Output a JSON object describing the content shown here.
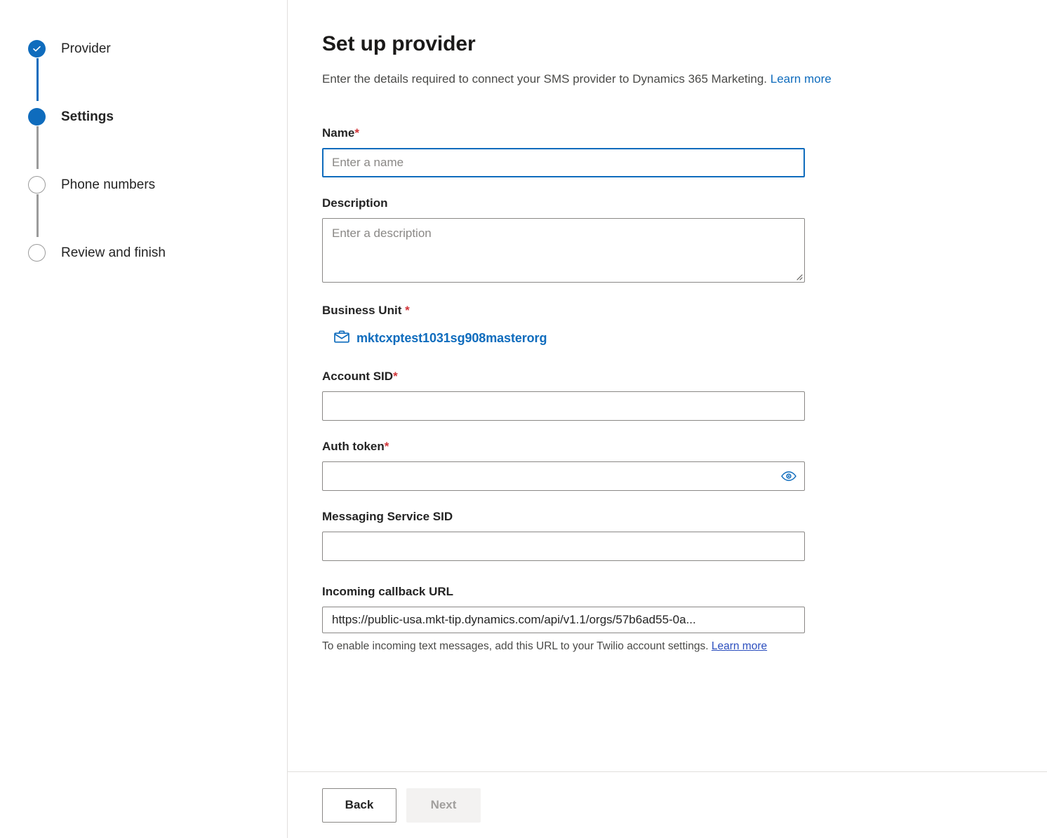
{
  "stepper": {
    "steps": [
      {
        "label": "Provider",
        "state": "done",
        "icon": "check-icon"
      },
      {
        "label": "Settings",
        "state": "current",
        "icon": "filled-circle-icon"
      },
      {
        "label": "Phone numbers",
        "state": "todo",
        "icon": "empty-circle-icon"
      },
      {
        "label": "Review and finish",
        "state": "todo",
        "icon": "empty-circle-icon"
      }
    ]
  },
  "header": {
    "title": "Set up provider",
    "subtitle": "Enter the details required to connect your SMS provider to Dynamics 365 Marketing.",
    "learn_more": "Learn more"
  },
  "form": {
    "name": {
      "label": "Name",
      "required_marker": "*",
      "placeholder": "Enter a name",
      "value": ""
    },
    "description": {
      "label": "Description",
      "placeholder": "Enter a description",
      "value": ""
    },
    "business_unit": {
      "label": "Business Unit ",
      "required_marker": "*",
      "icon": "briefcase-icon",
      "value": "mktcxptest1031sg908masterorg"
    },
    "account_sid": {
      "label": "Account SID",
      "required_marker": "*",
      "placeholder": "",
      "value": ""
    },
    "auth_token": {
      "label": "Auth token",
      "required_marker": "*",
      "placeholder": "",
      "value": "",
      "reveal_icon": "eye-icon"
    },
    "messaging_service_sid": {
      "label": "Messaging Service SID",
      "placeholder": "",
      "value": ""
    },
    "incoming_callback_url": {
      "label": "Incoming callback URL",
      "value": "https://public-usa.mkt-tip.dynamics.com/api/v1.1/orgs/57b6ad55-0a...",
      "help_text": "To enable incoming text messages, add this URL to your Twilio account settings. ",
      "help_link": "Learn more"
    }
  },
  "footer": {
    "back_label": "Back",
    "next_label": "Next"
  },
  "colors": {
    "accent": "#0f6cbd",
    "required": "#d13438",
    "link": "#0f6cbd",
    "link_visited": "#2b4ebe",
    "border": "#8a8886",
    "divider": "#e1dfdd",
    "disabled_bg": "#f3f2f1",
    "disabled_text": "#a19f9d",
    "step_todo": "#9b9b9b"
  }
}
